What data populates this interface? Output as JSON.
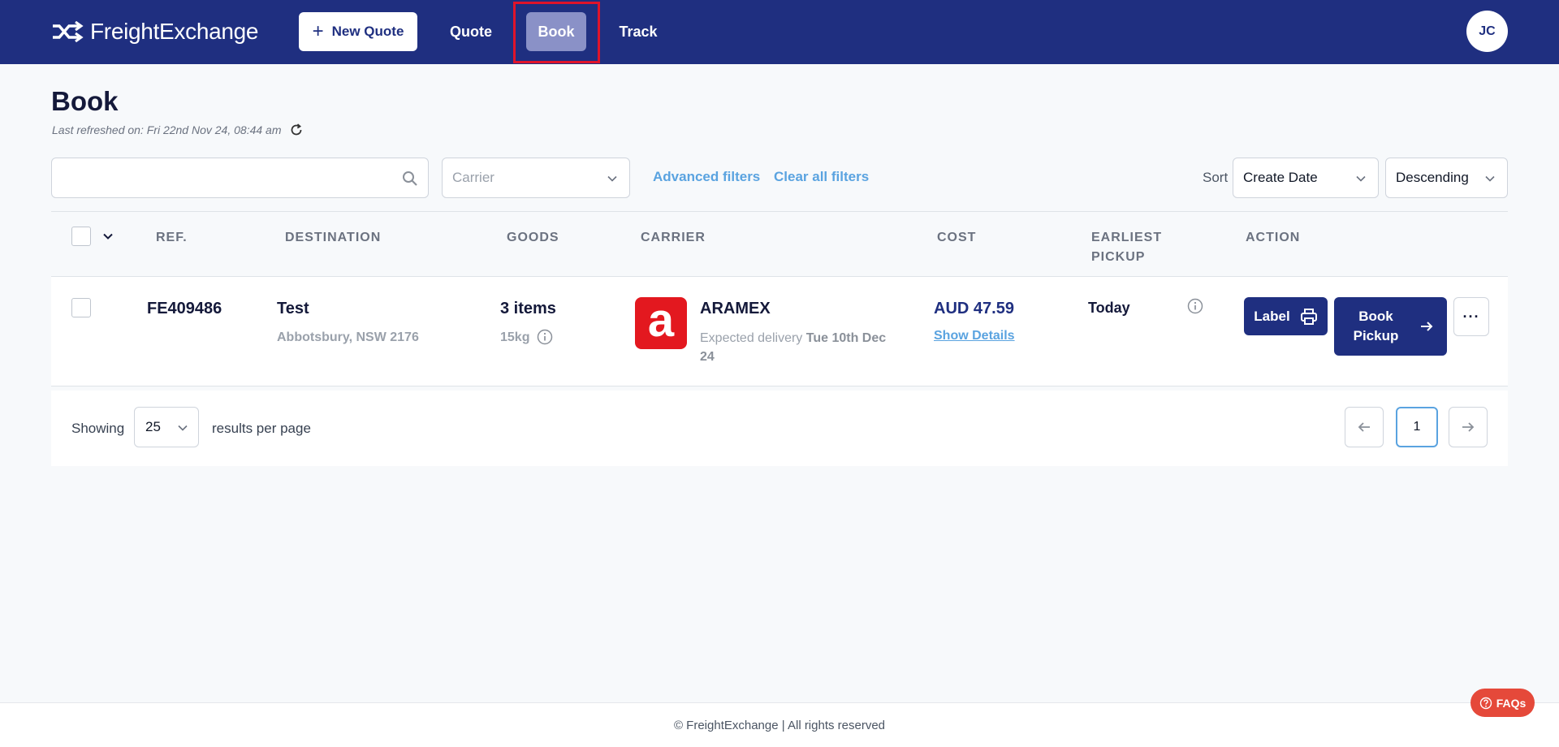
{
  "brand": {
    "name": "FreightExchange",
    "icon": "shuffle-arrows-icon"
  },
  "nav": {
    "new_quote_label": "New Quote",
    "items": [
      {
        "label": "Quote",
        "active": false
      },
      {
        "label": "Book",
        "active": true
      },
      {
        "label": "Track",
        "active": false
      }
    ],
    "user_initials": "JC"
  },
  "header": {
    "title": "Book",
    "last_refreshed": "Last refreshed on: Fri 22nd Nov 24, 08:44 am"
  },
  "filters": {
    "search": {
      "value": "",
      "placeholder": ""
    },
    "carrier_placeholder": "Carrier",
    "advanced_filters": "Advanced filters",
    "clear_all": "Clear all filters",
    "sort_label": "Sort",
    "sort_by": "Create Date",
    "sort_order": "Descending"
  },
  "table": {
    "columns": {
      "ref": "REF.",
      "destination": "DESTINATION",
      "goods": "GOODS",
      "carrier": "CARRIER",
      "cost": "COST",
      "earliest_pickup_1": "EARLIEST",
      "earliest_pickup_2": "PICKUP",
      "action": "ACTION"
    },
    "rows": [
      {
        "ref": "FE409486",
        "destination_name": "Test",
        "destination_address": "Abbotsbury, NSW 2176",
        "goods_count": "3 items",
        "goods_weight": "15kg",
        "carrier_name": "ARAMEX",
        "carrier_logo_letter": "a",
        "expected_prefix": "Expected delivery",
        "expected_date": "Tue 10th Dec 24",
        "cost": "AUD 47.59",
        "show_details": "Show Details",
        "earliest_pickup": "Today",
        "label_button": "Label",
        "book_button": "Book Pickup",
        "more_button": "···"
      }
    ]
  },
  "pagination": {
    "showing_label": "Showing",
    "per_page_value": "25",
    "per_page_label": "results per page",
    "current_page": "1"
  },
  "footer": {
    "text": "© FreightExchange | All rights reserved"
  },
  "faqs": {
    "label": "FAQs"
  },
  "colors": {
    "nav_bg": "#1f2f80",
    "active_nav_bg": "#8a91c7",
    "highlight_frame": "#e0142a",
    "link": "#5aa3e0",
    "aramex_red": "#e3181f",
    "faqs_bg": "#e5493a"
  }
}
